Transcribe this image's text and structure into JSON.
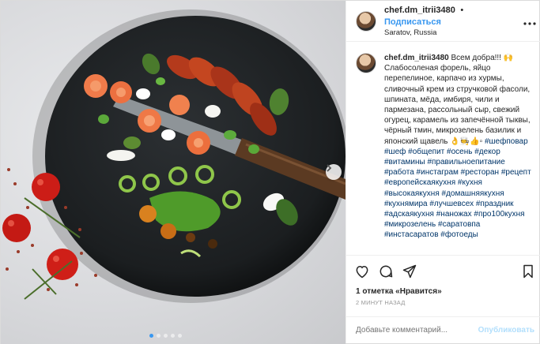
{
  "header": {
    "username": "chef.dm_itrii3480",
    "separator": "•",
    "follow_label": "Подписаться",
    "location": "Saratov, Russia",
    "more_icon": "more-horizontal-icon"
  },
  "caption": {
    "username": "chef.dm_itrii3480",
    "text": "Всем добра!!! 🙌 Слабосоленая форель, яйцо перепелиное, карпачо из хурмы, сливочный крем из стручковой фасоли, шпината, мёда, имбиря, чили и пармезана, рассольный сыр, свежий огурец, карамель из запечённой тыквы, чёрный тмин, микрозелень базилик и японский щавель 👌🧑‍🍳👍▫",
    "hashtags": "#шефповар #шеф #общепит #осень #декор #витамины #правильноепитание #работа #инстаграм #ресторан #рецепт #европейскаякухня #кухня #высокаякухня #домашняякухня #кухнямира #лучшевсех #праздник #адскаякухня #наножах #про100кухня #микрозелень #саратовпа #инстасаратов #фотоеды"
  },
  "actions": {
    "like_icon": "heart-icon",
    "comment_icon": "comment-icon",
    "share_icon": "share-icon",
    "save_icon": "bookmark-icon"
  },
  "likes": {
    "count_text": "1 отметка",
    "suffix": " «Нравится»"
  },
  "time": "2 МИНУТ НАЗАД",
  "comment_box": {
    "placeholder": "Добавьте комментарий...",
    "publish_label": "Опубликовать"
  },
  "carousel": {
    "total": 5,
    "active": 0
  },
  "colors": {
    "accent": "#3897f0",
    "hashtag": "#003569",
    "muted": "#999999"
  }
}
